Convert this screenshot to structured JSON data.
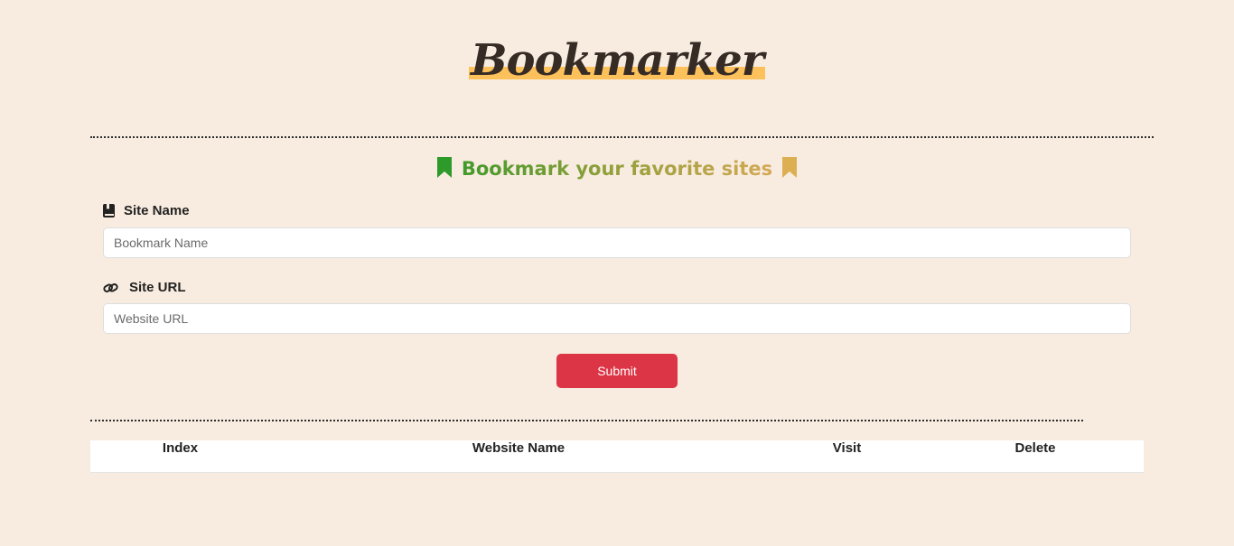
{
  "brand": {
    "title": "Bookmarker",
    "highlight_color": "#fcc15a"
  },
  "tagline": {
    "text": "Bookmark your favorite sites",
    "left_icon": "bookmark-icon",
    "right_icon": "bookmark-icon",
    "gradient_colors": [
      "#3f9a2a",
      "#d6a956"
    ]
  },
  "form": {
    "site_name": {
      "label": "Site Name",
      "icon": "book-icon",
      "placeholder": "Bookmark Name",
      "value": ""
    },
    "site_url": {
      "label": "Site URL",
      "icon": "link-icon",
      "placeholder": "Website URL",
      "value": ""
    },
    "submit_label": "Submit",
    "submit_color": "#dc3545"
  },
  "table": {
    "headers": [
      "Index",
      "Website Name",
      "Visit",
      "Delete"
    ],
    "rows": []
  },
  "colors": {
    "background": "#f8ece0"
  }
}
